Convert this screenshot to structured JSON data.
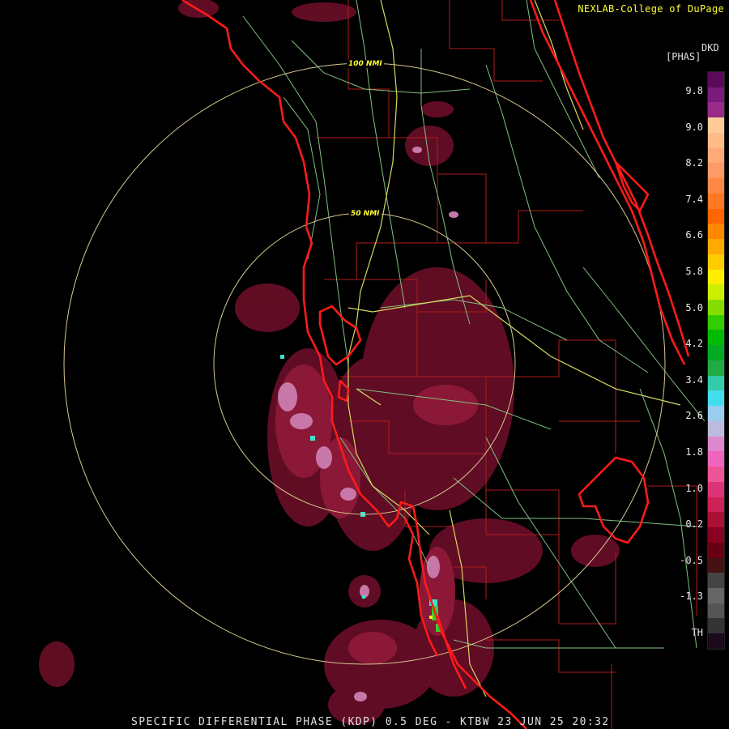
{
  "header": {
    "credit": "NEXLAB-College of DuPage",
    "product_code": "DKD",
    "unit": "[PHAS]"
  },
  "footer": {
    "caption": "SPECIFIC DIFFERENTIAL PHASE (KDP) 0.5 DEG - KTBW 23 JUN 25 20:32"
  },
  "range_rings": {
    "inner_label": "50 NMI",
    "outer_label": "100 NMI"
  },
  "colorbar": {
    "ticks": [
      "9.8",
      "9.0",
      "8.2",
      "7.4",
      "6.6",
      "5.8",
      "5.0",
      "4.2",
      "3.4",
      "2.6",
      "1.8",
      "1.0",
      "0.2",
      "-0.5",
      "-1.3",
      "TH"
    ],
    "colors": [
      "#5a0a5a",
      "#7a1a7a",
      "#9a2a8a",
      "#ffcc99",
      "#ffbb88",
      "#ffaa77",
      "#ff9966",
      "#ff8844",
      "#ff7722",
      "#ff6600",
      "#ff8800",
      "#ffaa00",
      "#ffcc00",
      "#ffee00",
      "#ccee00",
      "#88dd00",
      "#33cc00",
      "#00bb00",
      "#00aa22",
      "#22aa44",
      "#33ccaa",
      "#44ddee",
      "#99ccee",
      "#bbbbdd",
      "#dd88cc",
      "#ee66bb",
      "#ee5599",
      "#dd3377",
      "#cc2255",
      "#aa1133",
      "#880022",
      "#660011",
      "#441111",
      "#444444",
      "#666666",
      "#555555",
      "#333333",
      "#1a0a1a"
    ]
  },
  "colors": {
    "coast": "#ff1a1a",
    "county": "#b01c1c",
    "highway": "#d8d860",
    "road": "#80c080",
    "ring": "#d8c890",
    "echo_weak": "#7a1030",
    "echo_mid": "#a82050",
    "echo_pink": "#e090c0",
    "echo_cyan": "#40e0d0",
    "echo_green": "#30d030"
  }
}
